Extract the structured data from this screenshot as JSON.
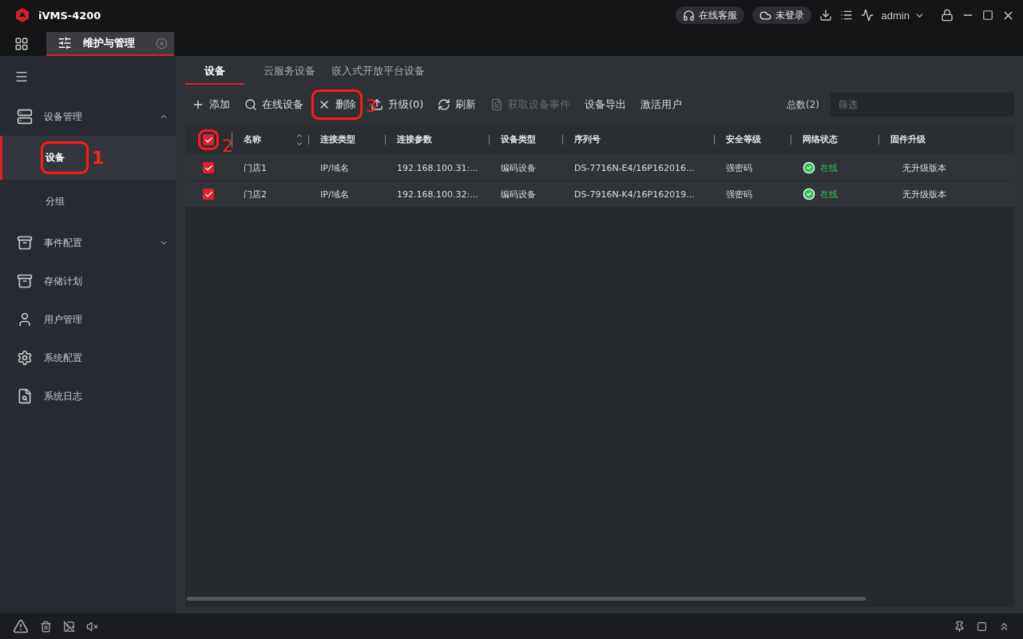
{
  "window": {
    "title": "iVMS-4200",
    "service": "在线客服",
    "login": "未登录",
    "user": "admin"
  },
  "app_tabs": [
    {
      "label": "维护与管理",
      "selected": true
    }
  ],
  "sidebar": {
    "items": [
      {
        "label": "设备管理",
        "kind": "group",
        "expanded": true,
        "children": [
          {
            "label": "设备",
            "selected": true,
            "annotation": "1"
          },
          {
            "label": "分组",
            "selected": false
          }
        ]
      },
      {
        "label": "事件配置",
        "kind": "group",
        "expanded": false
      },
      {
        "label": "存储计划",
        "kind": "item"
      },
      {
        "label": "用户管理",
        "kind": "item"
      },
      {
        "label": "系统配置",
        "kind": "item"
      },
      {
        "label": "系统日志",
        "kind": "item"
      }
    ]
  },
  "sub_tabs": [
    {
      "label": "设备",
      "selected": true
    },
    {
      "label": "云服务设备",
      "selected": false
    },
    {
      "label": "嵌入式开放平台设备",
      "selected": false
    }
  ],
  "toolbar": {
    "buttons": [
      {
        "label": "添加",
        "disabled": false
      },
      {
        "label": "在线设备",
        "disabled": false
      },
      {
        "label": "删除",
        "disabled": false,
        "annotation": "3"
      },
      {
        "label": "升级(0)",
        "disabled": false
      },
      {
        "label": "刷新",
        "disabled": false
      },
      {
        "label": "获取设备事件",
        "disabled": true
      },
      {
        "label": "设备导出",
        "disabled": false
      },
      {
        "label": "激活用户",
        "disabled": false
      }
    ],
    "total": "总数(2)",
    "filter_placeholder": "筛选"
  },
  "table": {
    "select_all": {
      "checked": true,
      "annotation": "2"
    },
    "columns": [
      "名称",
      "连接类型",
      "连接参数",
      "设备类型",
      "序列号",
      "安全等级",
      "网络状态",
      "固件升级"
    ],
    "rows": [
      {
        "checked": true,
        "cells": [
          "门店1",
          "IP/域名",
          "192.168.100.31:...",
          "编码设备",
          "DS-7716N-E4/16P162016...",
          "强密码",
          "在线",
          "无升级版本"
        ],
        "online": true
      },
      {
        "checked": true,
        "cells": [
          "门店2",
          "IP/域名",
          "192.168.100.32:...",
          "编码设备",
          "DS-7916N-K4/16P162019...",
          "强密码",
          "在线",
          "无升级版本"
        ],
        "online": true
      }
    ]
  }
}
